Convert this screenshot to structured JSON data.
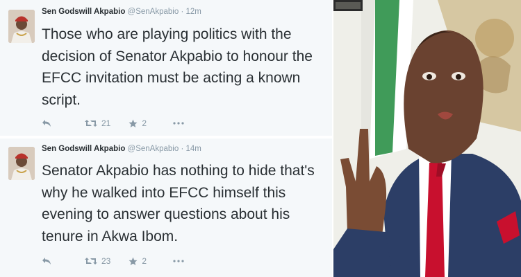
{
  "tweets": [
    {
      "name": "Sen Godswill Akpabio",
      "handle": "@SenAkpabio",
      "separator": "·",
      "time": "12m",
      "text": "Those who are playing politics with the decision of Senator Akpabio to honour the EFCC invitation must be acting a known script.",
      "retweets": "21",
      "favorites": "2",
      "icons": [
        "reply-icon",
        "retweet-icon",
        "favorite-icon",
        "more-icon"
      ]
    },
    {
      "name": "Sen Godswill Akpabio",
      "handle": "@SenAkpabio",
      "separator": "·",
      "time": "14m",
      "text": "Senator Akpabio has nothing to hide that's why he walked into EFCC himself this evening to answer questions about his tenure in Akwa Ibom.",
      "retweets": "23",
      "favorites": "2",
      "icons": [
        "reply-icon",
        "retweet-icon",
        "favorite-icon",
        "more-icon"
      ]
    }
  ],
  "colors": {
    "tweet_bg": "#f5f8fa",
    "text": "#292f33",
    "muted": "#8899a6",
    "suit": "#2c3e66",
    "tie": "#c8102e"
  }
}
